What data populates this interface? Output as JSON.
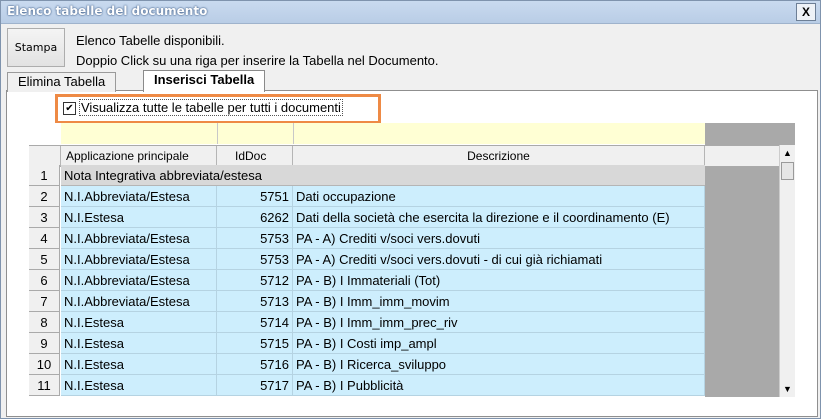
{
  "window": {
    "title": "Elenco tabelle del documento",
    "close_label": "X"
  },
  "toolbar": {
    "print_label": "Stampa"
  },
  "info": {
    "line1": "Elenco Tabelle disponibili.",
    "line2": "Doppio Click su una riga per inserire la Tabella nel Documento."
  },
  "tabs": [
    {
      "label": "Elimina Tabella",
      "active": false
    },
    {
      "label": "Inserisci Tabella",
      "active": true
    }
  ],
  "filter": {
    "checked": true,
    "label": "Visualizza tutte le tabelle per tutti i documenti"
  },
  "grid": {
    "headers": {
      "app": "Applicazione principale",
      "iddoc": "IdDoc",
      "desc": "Descrizione"
    },
    "group_label": "Nota Integrativa abbreviata/estesa",
    "rows": [
      {
        "num": "2",
        "app": "N.I.Abbreviata/Estesa",
        "iddoc": "5751",
        "desc": "Dati occupazione"
      },
      {
        "num": "3",
        "app": "N.I.Estesa",
        "iddoc": "6262",
        "desc": "Dati della società che esercita la direzione e il coordinamento (E)"
      },
      {
        "num": "4",
        "app": "N.I.Abbreviata/Estesa",
        "iddoc": "5753",
        "desc": "PA - A) Crediti v/soci vers.dovuti"
      },
      {
        "num": "5",
        "app": "N.I.Abbreviata/Estesa",
        "iddoc": "5753",
        "desc": "PA - A) Crediti v/soci vers.dovuti - di cui già richiamati"
      },
      {
        "num": "6",
        "app": "N.I.Abbreviata/Estesa",
        "iddoc": "5712",
        "desc": "PA - B) I Immateriali (Tot)"
      },
      {
        "num": "7",
        "app": "N.I.Abbreviata/Estesa",
        "iddoc": "5713",
        "desc": "PA - B) I Imm_imm_movim"
      },
      {
        "num": "8",
        "app": "N.I.Estesa",
        "iddoc": "5714",
        "desc": "PA - B) I Imm_imm_prec_riv"
      },
      {
        "num": "9",
        "app": "N.I.Estesa",
        "iddoc": "5715",
        "desc": "PA - B) I Costi imp_ampl"
      },
      {
        "num": "10",
        "app": "N.I.Estesa",
        "iddoc": "5716",
        "desc": "PA - B) I Ricerca_sviluppo"
      },
      {
        "num": "11",
        "app": "N.I.Estesa",
        "iddoc": "5717",
        "desc": "PA - B) I Pubblicità"
      }
    ]
  }
}
